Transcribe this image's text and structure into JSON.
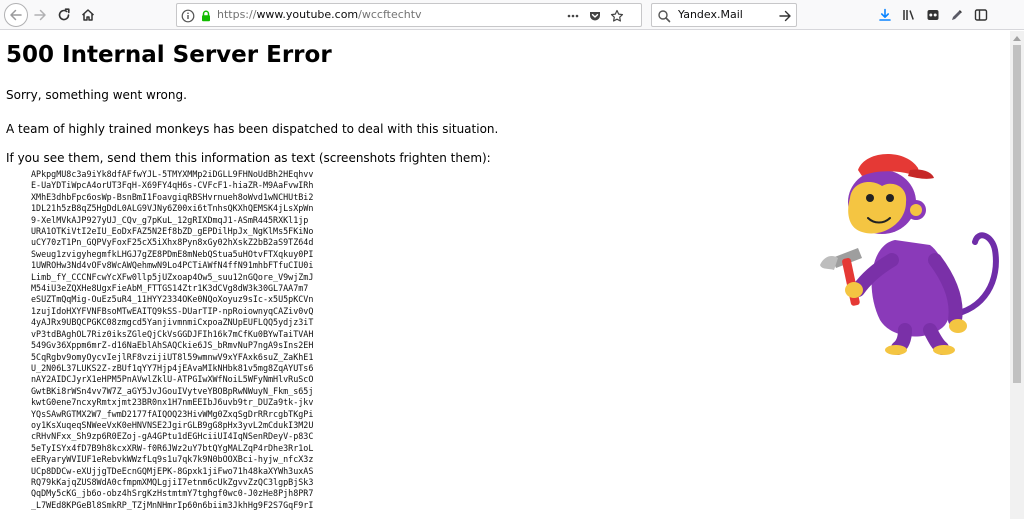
{
  "browser": {
    "url": {
      "scheme": "https://",
      "host": "www.youtube.com",
      "path": "/wccftechtv"
    },
    "search": {
      "value": "Yandex.Mail"
    },
    "icons": {
      "back": "back-arrow-icon",
      "forward": "forward-arrow-icon",
      "reload": "reload-icon",
      "home": "home-icon",
      "info": "site-info-icon",
      "lock": "lock-icon",
      "pocket": "pocket-icon",
      "page_actions": "chevron-down-icon",
      "bookmark": "bookmark-star-icon",
      "search": "search-icon",
      "search_go": "arrow-right-icon",
      "downloads": "download-icon",
      "library": "library-icon",
      "private": "mask-icon",
      "extension": "pen-icon",
      "sidebar": "sidebar-icon"
    },
    "colors": {
      "accent": "#0a84ff",
      "lock": "#12bc00"
    }
  },
  "page": {
    "title": "500 Internal Server Error",
    "message": "Sorry, something went wrong.",
    "detail": "A team of highly trained monkeys has been dispatched to deal with this situation.",
    "instruction": "If you see them, send them this information as text (screenshots frighten them):",
    "debug_text": "APkpgMU8c3a9iYk8dfAFfwYJL-5TMYXMMp2iDGLL9FHNoUdBh2HEqhvv\nE-UaYDTiWpcA4orUT3FqH-X69FY4qH6s-CVFcF1-hiaZR-M9AaFvwIRh\nXMhE3dhbFpc6osWp-BsnBmI1FoavgiqRBSHvrnueh8oWvd1wNCHUtBi2\n1DL21h5zB8qZ5HgDdL0ALG9VJNy6Z00xi6tTnhsQKXhQEMSK4jLsXpWn\n9-XelMVkAJP927yUJ_CQv_g7pKuL_12gRIXDmqJ1-ASmR445RXKl1jp\nURA1OTKiVtI2eIU_EoDxFAZ5N2Ef8bZD_gEPDilHpJx_NgKlMs5FKiNo\nuCY70zT1Pn_GQPVyFoxF25cX5iXhx8Pyn8xGy02hXskZ2bB2aS9TZ64d\nSweug1zvigyhegmfkLHGJ7gZE8PDmE8mNebQStua5uHOtvFTXqkuy0PI\n1UWROHw3Nd4vOFv8WcAWQehmwN9Lo4PCTiAWfN4ffN91mhbFTfuCIU0i\nLimb_fY_CCCNFcwYcXFw0llp5jUZxoap4Ow5_suu12nGQore_V9wjZmJ\nM54iU3eZQXHe8UgxFieAbM_FTTGS14Ztr1K3dCVg8dW3k30GL7AA7m7\neSUZTmQqMig-OuEz5uR4_11HYY2334OKe0NQoXoyuz9sIc-x5U5pKCVn\n1zujIdoHXYFVNFBsoMTwEAITQ9kSS-DUarTIP-npRoiownyqCAZiv0vQ\n4yAJRx9UBQCPGKC08zmgcd5YanjivmnmiCxpoaZNUpEUFLQQ5ydjz3iT\nvP3tdBAghOL7Riz0iksZGleQjCkVsGGDJFIh16k7mCfKu0BYwTaiTVAH\n549Gv36Xppm6mrZ-d16NaEblAhSAQCkie6JS_bRmvNuP7ngA9sIns2EH\n5CqRgbv9omyOycvIejlRF8vzijiUT8l59wmnwV9xYFAxk6suZ_ZaKhE1\nU_2N06L37LUKS2Z-zBUf1qYY7Hjp4jEAvaMIkNHbk81v5mg8ZqAYUTs6\nnAY2AIDCJyrX1eHPM5PnAVwlZklU-ATPGIwXWfNoiL5WFyNmHlvRuScO\nGwtBKi8rWSn4vv7W7Z_aGY5JvJGouIVytveYBOBpRwNWuyN_Fkm_s65j\nkwtG0ene7ncxyRmtxjmt23BR0nx1H7nmEEIbJ6uvb9tr_DUZa9tk-jkv\nYQsSAwRGTMX2W7_fwmD2177fAIQOQ23HivWMg0ZxqSgDrRRrcgbTKgPi\noy1KsXuqeqSNWeeVxK0eHNVNSE2JgirGLB9gG8pHx3yvL2mCdukI3M2U\ncRHvNFxx_Sh9zp6R0EZoj-gA4GPtu1dEGHciiUI4IqNSenRDeyV-p83C\n5eTyISYx4fD7B9h8kcxXRW-f0R6JWz2uY7btQYgMALZqP4rDhe3Rr1oL\neERyaryWVIUF1eRebvkWWzfLq9s1u7qk7k9N0bOOXBci-hyjw_nfcX3z\nUCp8DDCw-eXUjjgTDeEcnGQMjEPK-8Gpxk1jiFwo71h48kaXYWh3uxAS\nRQ79kKajqZUS8WdA0cfmpmXMQLgjiI7etnm6cUkZgvvZzQC3lgpBjSk3\nQqDMy5cKG_jb6o-obz4hSrgKzHstmtmY7tghgf0wc0-J0zHe8Pjh8PR7\n_L7WEd8KPGeBl8SmkRP_TZjMnNHmrIp60n6biim3JkhHg9F2S7GqF9rI"
  }
}
